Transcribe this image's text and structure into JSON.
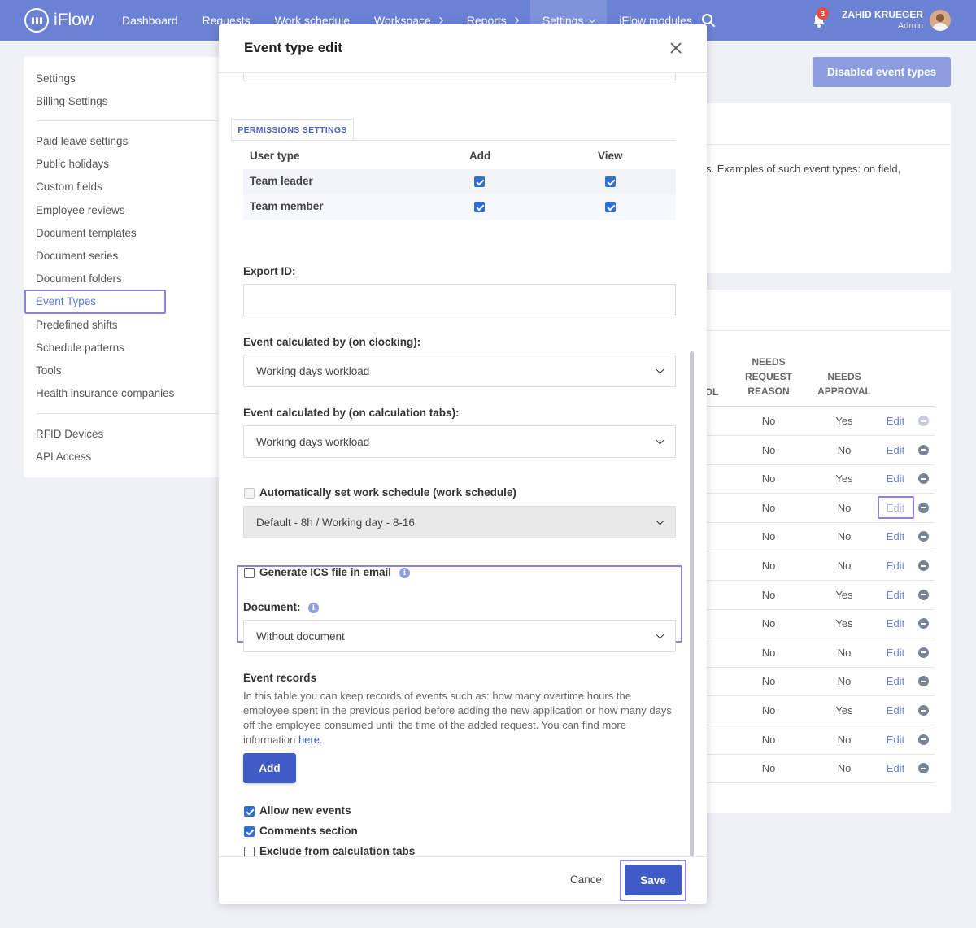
{
  "app": {
    "logo_text": "iFlow"
  },
  "nav": {
    "items": [
      {
        "label": "Dashboard",
        "has_chevron": false
      },
      {
        "label": "Requests",
        "has_chevron": false
      },
      {
        "label": "Work schedule",
        "has_chevron": false
      },
      {
        "label": "Workspace",
        "has_chevron": true
      },
      {
        "label": "Reports",
        "has_chevron": true
      },
      {
        "label": "Settings",
        "has_chevron": true,
        "active": true
      },
      {
        "label": "iFlow modules",
        "has_chevron": false
      }
    ],
    "search_icon": "search-icon",
    "notifications_count": "3",
    "user_name": "ZAHID KRUEGER",
    "user_role": "Admin"
  },
  "sidebar": {
    "group1": [
      "Settings",
      "Billing Settings"
    ],
    "group2": [
      "Paid leave settings",
      "Public holidays",
      "Custom fields",
      "Employee reviews",
      "Document templates",
      "Document series",
      "Document folders",
      "Event Types",
      "Predefined shifts",
      "Schedule patterns",
      "Tools",
      "Health insurance companies"
    ],
    "group3": [
      "RFID Devices",
      "API Access"
    ],
    "selected": "Event Types"
  },
  "page": {
    "disabled_button": "Disabled event types",
    "description_fragment": "s. Examples of such event types: on field,"
  },
  "table": {
    "col_partial": "OL",
    "col_reason": "NEEDS\nREQUEST\nREASON",
    "col_approval": "NEEDS\nAPPROVAL",
    "rows": [
      {
        "reason": "No",
        "approval": "Yes",
        "action": "Edit",
        "remove_disabled": true
      },
      {
        "reason": "No",
        "approval": "No",
        "action": "Edit"
      },
      {
        "reason": "No",
        "approval": "Yes",
        "action": "Edit"
      },
      {
        "reason": "No",
        "approval": "No",
        "action": "Edit",
        "highlighted": true
      },
      {
        "reason": "No",
        "approval": "No",
        "action": "Edit"
      },
      {
        "reason": "No",
        "approval": "No",
        "action": "Edit"
      },
      {
        "reason": "No",
        "approval": "Yes",
        "action": "Edit"
      },
      {
        "reason": "No",
        "approval": "Yes",
        "action": "Edit"
      },
      {
        "reason": "No",
        "approval": "No",
        "action": "Edit"
      },
      {
        "reason": "No",
        "approval": "No",
        "action": "Edit"
      },
      {
        "reason": "No",
        "approval": "Yes",
        "action": "Edit"
      },
      {
        "reason": "No",
        "approval": "No",
        "action": "Edit"
      },
      {
        "reason": "No",
        "approval": "No",
        "action": "Edit"
      }
    ]
  },
  "modal": {
    "title": "Event type edit",
    "permissions": {
      "tab": "PERMISSIONS SETTINGS",
      "col_user_type": "User type",
      "col_add": "Add",
      "col_view": "View",
      "rows": [
        {
          "name": "Team leader",
          "add": true,
          "view": true
        },
        {
          "name": "Team member",
          "add": true,
          "view": true
        }
      ]
    },
    "export_id": {
      "label": "Export ID:",
      "value": ""
    },
    "calc_clocking": {
      "label": "Event calculated by (on clocking):",
      "value": "Working days workload"
    },
    "calc_tabs": {
      "label": "Event calculated by (on calculation tabs):",
      "value": "Working days workload"
    },
    "auto_schedule": {
      "label": "Automatically set work schedule (work schedule)",
      "checked": false,
      "value": "Default - 8h / Working day - 8-16"
    },
    "ics": {
      "label": "Generate ICS file in email",
      "checked": false
    },
    "document": {
      "label": "Document:",
      "value": "Without document"
    },
    "event_records": {
      "title": "Event records",
      "text": "In this table you can keep records of events such as: how many overtime hours the employee spent in the previous period before adding the new application or how many days off the employee consumed until the time of the added request. You can find more information",
      "link": "here",
      "suffix": ".",
      "add_button": "Add"
    },
    "options": [
      {
        "label": "Allow new events",
        "checked": true
      },
      {
        "label": "Comments section",
        "checked": true
      },
      {
        "label": "Exclude from calculation tabs",
        "checked": false
      }
    ],
    "cancel": "Cancel",
    "save": "Save"
  },
  "colors": {
    "nav": "#6b82d4",
    "primary": "#3f5bc6",
    "highlight": "#8e83d9",
    "link": "#6b82d4"
  }
}
